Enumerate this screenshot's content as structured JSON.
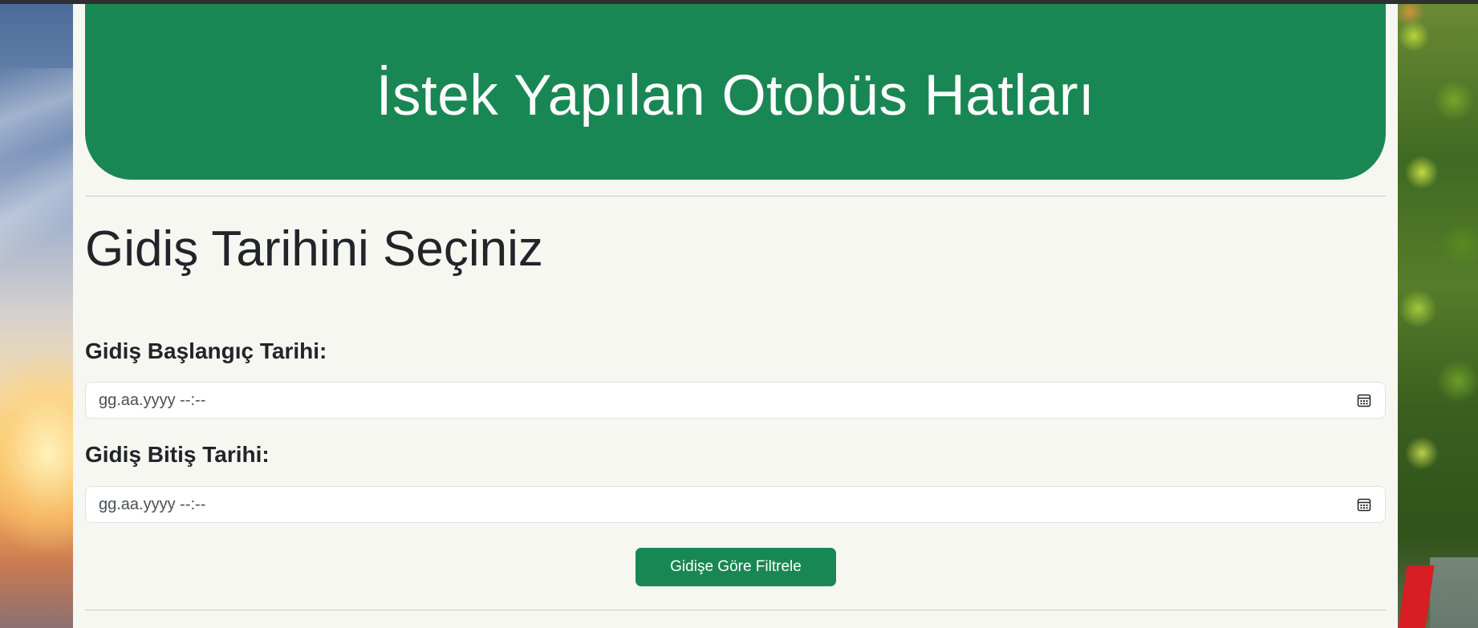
{
  "header": {
    "title": "İstek Yapılan Otobüs Hatları"
  },
  "section": {
    "title": "Gidiş Tarihini Seçiniz"
  },
  "form": {
    "start_label": "Gidiş Başlangıç Tarihi:",
    "start_placeholder": "gg.aa.yyyy --:--",
    "end_label": "Gidiş Bitiş Tarihi:",
    "end_placeholder": "gg.aa.yyyy --:--",
    "calendar_icon": "calendar-icon",
    "filter_button_label": "Gidişe Göre Filtrele"
  },
  "colors": {
    "brand_green": "#198754",
    "panel_background": "#f7f7f2",
    "text_dark": "#212529"
  }
}
